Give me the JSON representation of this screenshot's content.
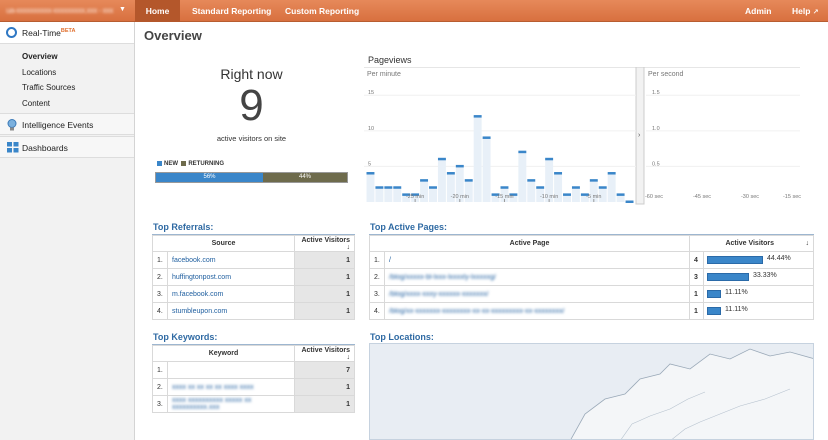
{
  "topnav": {
    "account": "ua-xxxxxxxxxx-xxxxxxxxx.xxx - xxx",
    "home": "Home",
    "standard": "Standard Reporting",
    "custom": "Custom Reporting",
    "admin": "Admin",
    "help": "Help"
  },
  "sidebar": {
    "realtime": "Real-Time",
    "beta": "BETA",
    "items": [
      "Overview",
      "Locations",
      "Traffic Sources",
      "Content"
    ],
    "intelligence": "Intelligence Events",
    "dashboards": "Dashboards"
  },
  "page_title": "Overview",
  "rightnow": {
    "label": "Right now",
    "count": "9",
    "caption": "active visitors on site",
    "legend_new": "NEW",
    "legend_returning": "RETURNING",
    "new_pct": "56%",
    "returning_pct": "44%",
    "new_fraction": 0.56,
    "colors": {
      "new": "#3a86c9",
      "returning": "#6e6b4c"
    }
  },
  "pageviews": {
    "title": "Pageviews",
    "per_minute": "Per minute",
    "per_second": "Per second",
    "y_ticks_min": [
      "15",
      "10",
      "5"
    ],
    "x_ticks_min": [
      "-25 min",
      "-20 min",
      "-15 min",
      "-10 min",
      "-5 min"
    ],
    "y_ticks_sec": [
      "1.5",
      "1.0",
      "0.5"
    ],
    "x_ticks_sec": [
      "-60 sec",
      "-45 sec",
      "-30 sec",
      "-15 sec"
    ]
  },
  "chart_data": {
    "type": "bar",
    "title": "Pageviews",
    "subtitle": "Per minute",
    "ylim": [
      0,
      17
    ],
    "x": [
      -30,
      -29,
      -28,
      -27,
      -26,
      -25,
      -24,
      -23,
      -22,
      -21,
      -20,
      -19,
      -18,
      -17,
      -16,
      -15,
      -14,
      -13,
      -12,
      -11,
      -10,
      -9,
      -8,
      -7,
      -6,
      -5,
      -4,
      -3,
      -2,
      -1
    ],
    "values": [
      4,
      2,
      2,
      2,
      1,
      1,
      3,
      2,
      6,
      4,
      5,
      3,
      12,
      9,
      1,
      2,
      1,
      7,
      3,
      2,
      6,
      4,
      1,
      2,
      1,
      3,
      2,
      4,
      1,
      0
    ],
    "per_second_values": []
  },
  "referrals": {
    "title": "Top Referrals:",
    "col_source": "Source",
    "col_visitors": "Active Visitors",
    "rows": [
      {
        "n": "1.",
        "src": "facebook.com",
        "v": "1"
      },
      {
        "n": "2.",
        "src": "huffingtonpost.com",
        "v": "1"
      },
      {
        "n": "3.",
        "src": "m.facebook.com",
        "v": "1"
      },
      {
        "n": "4.",
        "src": "stumbleupon.com",
        "v": "1"
      }
    ]
  },
  "pages": {
    "title": "Top Active Pages:",
    "col_page": "Active Page",
    "col_visitors": "Active Visitors",
    "rows": [
      {
        "n": "1.",
        "page": "/",
        "v": "4",
        "pct": "44.44%",
        "frac": 0.4444
      },
      {
        "n": "2.",
        "page": "/blog/xxxxx-bl-lxxx-lxxxxly-lxxxxxg/",
        "v": "3",
        "pct": "33.33%",
        "frac": 0.3333
      },
      {
        "n": "3.",
        "page": "/blog/xxxx-xxxy-xxxxxx-xxxxxxx/",
        "v": "1",
        "pct": "11.11%",
        "frac": 0.1111
      },
      {
        "n": "4.",
        "page": "/blog/xx-xxxxxxx-xxxxxxxx-xx-xx-xxxxxxxxx-xx-xxxxxxxx/",
        "v": "1",
        "pct": "11.11%",
        "frac": 0.1111
      }
    ]
  },
  "keywords": {
    "title": "Top Keywords:",
    "col_keyword": "Keyword",
    "col_visitors": "Active Visitors",
    "rows": [
      {
        "n": "1.",
        "kw": "",
        "v": "7"
      },
      {
        "n": "2.",
        "kw": "xxxx xx xx xx xx xxxx xxxx",
        "v": "1"
      },
      {
        "n": "3.",
        "kw": "xxxx xxxxxxxxxx xxxxx xx xxxxxxxxxx.xxx",
        "v": "1"
      }
    ]
  },
  "locations": {
    "title": "Top Locations:"
  }
}
